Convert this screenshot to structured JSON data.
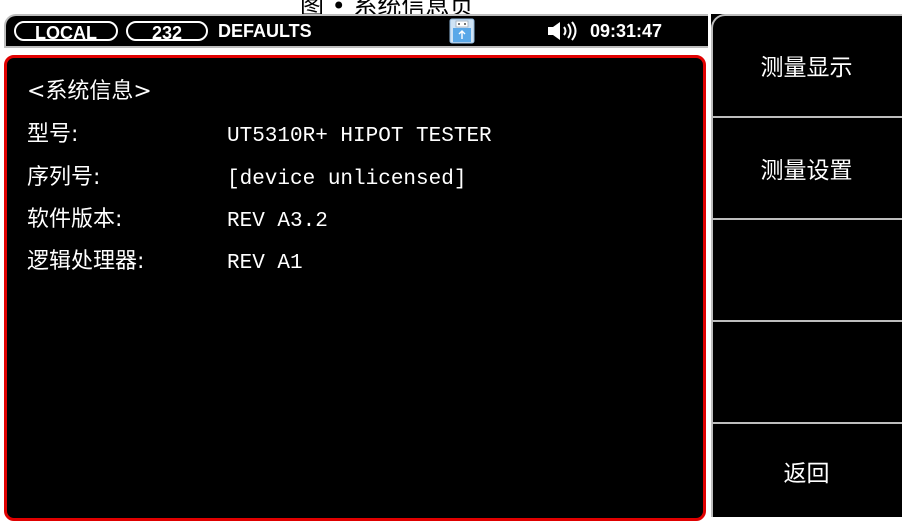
{
  "caption": "图   • 系统信息页",
  "status_bar": {
    "remote_mode": "LOCAL",
    "interface": "232",
    "setup_name": "DEFAULTS",
    "usb_icon": "usb-drive-icon",
    "speaker_icon": "speaker-icon",
    "time": "09:31:47"
  },
  "panel": {
    "title": "<系统信息>",
    "rows": [
      {
        "label": "型号:",
        "value": "UT5310R+ HIPOT TESTER"
      },
      {
        "label": "序列号:",
        "value": "[device unlicensed]"
      },
      {
        "label": "软件版本:",
        "value": "REV A3.2"
      },
      {
        "label": "逻辑处理器:",
        "value": "REV A1"
      }
    ]
  },
  "softkeys": [
    "测量显示",
    "测量设置",
    "",
    "",
    "返回"
  ],
  "colors": {
    "background": "#000000",
    "panel_border": "#e00000",
    "text": "#ffffff",
    "separator": "#bdbdbd"
  }
}
